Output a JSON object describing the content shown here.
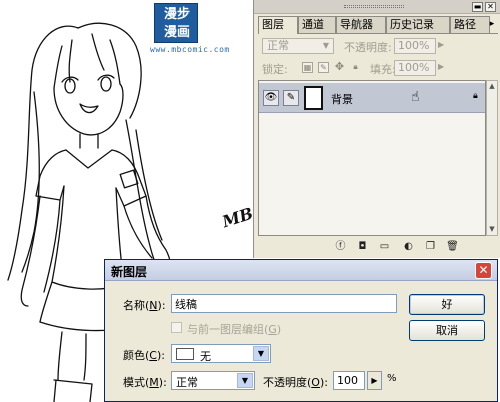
{
  "logo": {
    "line1": "漫步",
    "line2": "漫画",
    "url": "www.mbcomic.com"
  },
  "artist_sign": "MB",
  "palette": {
    "tabs": [
      "图层",
      "通道",
      "导航器",
      "历史记录",
      "路径"
    ],
    "menu_arrow": "▸",
    "blend_mode": "正常",
    "opacity_label": "不透明度:",
    "opacity_value": "100%",
    "lock_label": "锁定:",
    "fill_label": "填充:",
    "fill_value": "100%",
    "layer": {
      "name": "背景"
    }
  },
  "dialog": {
    "title": "新图层",
    "close": "✕",
    "name_label": "名称",
    "name_key": "N",
    "name_value": "线稿",
    "ok_label": "好",
    "cancel_label": "取消",
    "group_label": "与前一图层编组",
    "group_key": "G",
    "color_label": "颜色",
    "color_key": "C",
    "color_value": "无",
    "mode_label": "模式",
    "mode_key": "M",
    "mode_value": "正常",
    "opacity_label": "不透明度",
    "opacity_key": "O",
    "opacity_value": "100",
    "percent": "%"
  }
}
